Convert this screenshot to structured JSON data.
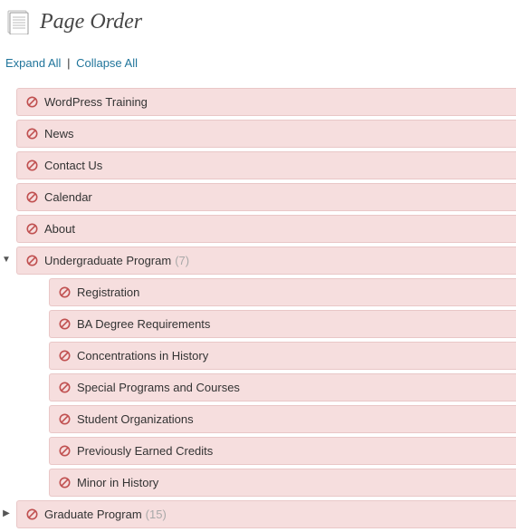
{
  "header": {
    "title": "Page Order"
  },
  "controls": {
    "expand": "Expand All",
    "collapse": "Collapse All",
    "separator": "|"
  },
  "pages": [
    {
      "label": "WordPress Training",
      "children": [],
      "expanded": false,
      "count": null
    },
    {
      "label": "News",
      "children": [],
      "expanded": false,
      "count": null
    },
    {
      "label": "Contact Us",
      "children": [],
      "expanded": false,
      "count": null
    },
    {
      "label": "Calendar",
      "children": [],
      "expanded": false,
      "count": null
    },
    {
      "label": "About",
      "children": [],
      "expanded": false,
      "count": null
    },
    {
      "label": "Undergraduate Program",
      "expanded": true,
      "count": 7,
      "children": [
        {
          "label": "Registration"
        },
        {
          "label": "BA Degree Requirements"
        },
        {
          "label": "Concentrations in History"
        },
        {
          "label": "Special Programs and Courses"
        },
        {
          "label": "Student Organizations"
        },
        {
          "label": "Previously Earned Credits"
        },
        {
          "label": "Minor in History"
        }
      ]
    },
    {
      "label": "Graduate Program",
      "expanded": false,
      "count": 15,
      "children": []
    }
  ]
}
